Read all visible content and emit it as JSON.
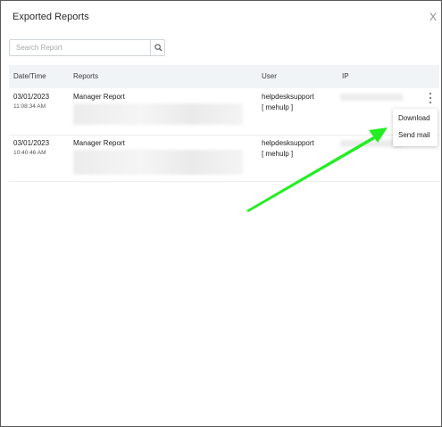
{
  "dialog": {
    "title": "Exported Reports",
    "close_label": "X"
  },
  "search": {
    "placeholder": "Search Report",
    "value": ""
  },
  "table": {
    "headers": [
      "Date/Time",
      "Reports",
      "User",
      "IP"
    ],
    "rows": [
      {
        "date": "03/01/2023",
        "time": "11:08:34 AM",
        "report": "Manager Report",
        "user": "helpdesksupport",
        "user_tag": "[ mehulp ]"
      },
      {
        "date": "03/01/2023",
        "time": "10:40:46 AM",
        "report": "Manager Report",
        "user": "helpdesksupport",
        "user_tag": "[ mehulp ]"
      }
    ]
  },
  "context_menu": {
    "items": [
      "Download",
      "Send mail"
    ]
  },
  "annotation": {
    "arrow_color": "#22ee22"
  },
  "icons": {
    "search": "search-icon",
    "close": "close-icon",
    "more": "more-vertical-icon",
    "arrow": "arrow-icon"
  }
}
